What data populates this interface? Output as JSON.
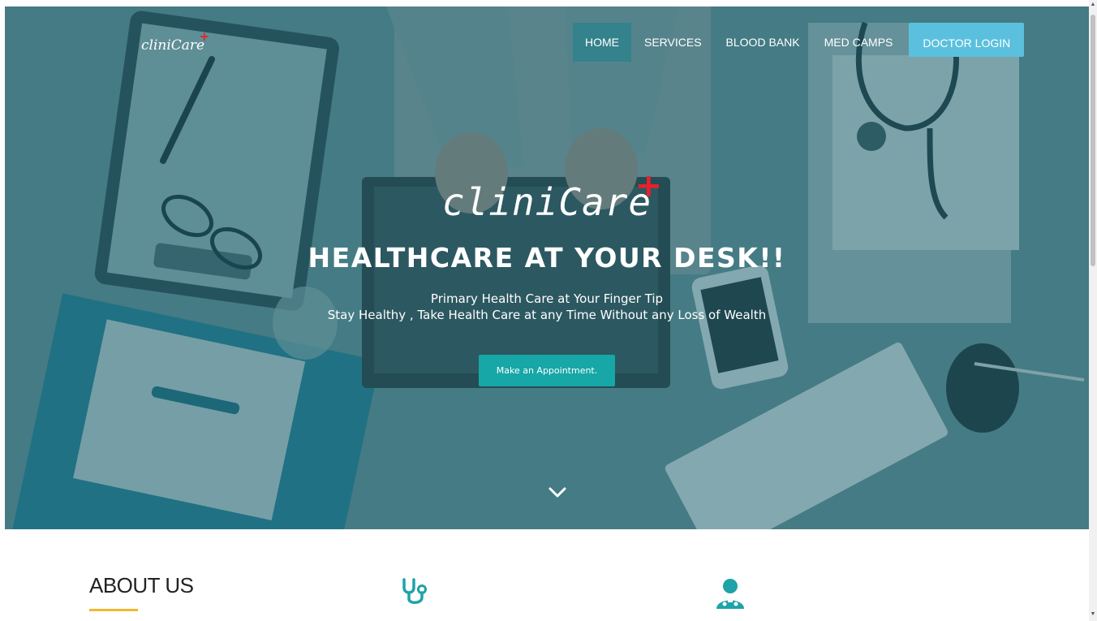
{
  "nav": {
    "brand": "cliniCare",
    "items": [
      {
        "label": "HOME",
        "active": true
      },
      {
        "label": "SERVICES"
      },
      {
        "label": "BLOOD BANK"
      },
      {
        "label": "MED CAMPS"
      }
    ],
    "login_label": "DOCTOR LOGIN"
  },
  "hero": {
    "logo": "cliniCare",
    "cross": "+",
    "headline": "HEALTHCARE AT YOUR DESK!!",
    "subtitle_1": "Primary Health Care at Your Finger Tip",
    "subtitle_2": "Stay Healthy , Take Health Care at any Time Without any Loss of Wealth",
    "cta_label": "Make an Appointment.",
    "scroll_icon": "chevron-down-icon"
  },
  "about": {
    "title": "ABOUT US",
    "icons": [
      "stethoscope-icon",
      "doctor-icon"
    ]
  },
  "colors": {
    "overlay": "#1b606e",
    "cta": "#16a7a6",
    "login": "#5bc0de",
    "accent_line": "#f2b830",
    "icon": "#1ea3a8",
    "cross": "#e8202c"
  }
}
